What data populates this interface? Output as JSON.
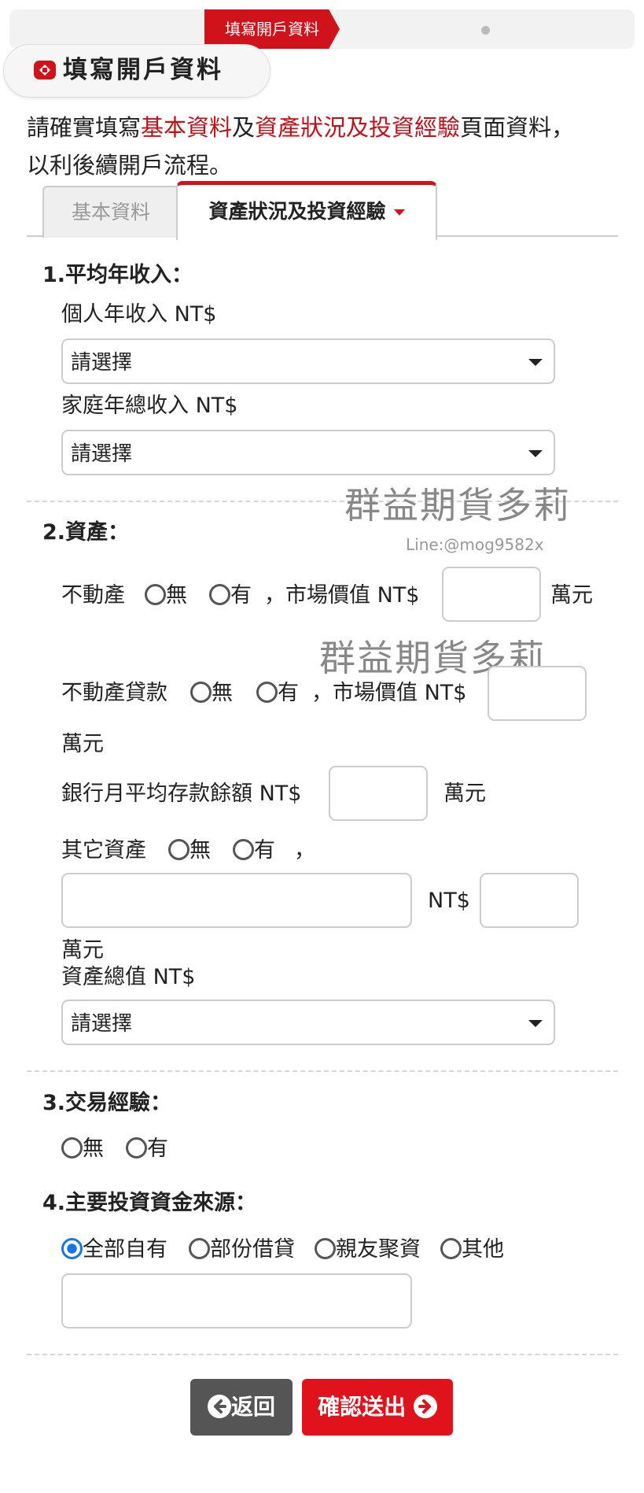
{
  "progress": {
    "active_step": "填寫開戶資料"
  },
  "header": {
    "title": "填寫開戶資料"
  },
  "intro": {
    "part1": "請確實填寫",
    "link1": "基本資料",
    "part2": "及",
    "link2": "資產狀況及投資經驗",
    "part3": "頁面資料，",
    "line2": "以利後續開戶流程。"
  },
  "tabs": [
    {
      "label": "基本資料"
    },
    {
      "label": "資產狀況及投資經驗"
    }
  ],
  "income": {
    "heading": "1.平均年收入：",
    "personal_label": "個人年收入 NT$",
    "personal_value": "請選擇",
    "family_label": "家庭年總收入 NT$",
    "family_value": "請選擇"
  },
  "assets": {
    "heading": "2.資產：",
    "real_estate": {
      "label": "不動產",
      "no": "無",
      "yes": "有",
      "market_value": "，市場價值 NT$",
      "unit": "萬元"
    },
    "real_estate_loan": {
      "label": "不動產貸款",
      "no": "無",
      "yes": "有",
      "market_value": "，市場價值 NT$",
      "unit": "萬元"
    },
    "bank_deposit": {
      "label": "銀行月平均存款餘額 NT$",
      "unit": "萬元"
    },
    "other_assets": {
      "label": "其它資產",
      "no": "無",
      "yes": "有",
      "comma": "，",
      "nt": "NT$",
      "unit": "萬元"
    },
    "total": {
      "label": "資產總值 NT$",
      "value": "請選擇"
    }
  },
  "trading": {
    "heading": "3.交易經驗：",
    "no": "無",
    "yes": "有"
  },
  "funds": {
    "heading": "4.主要投資資金來源：",
    "options": [
      "全部自有",
      "部份借貸",
      "親友聚資",
      "其他"
    ],
    "selected": "全部自有"
  },
  "watermark": {
    "text": "群益期貨多莉",
    "line": "Line:@mog9582x"
  },
  "buttons": {
    "back": "返回",
    "submit": "確認送出"
  },
  "colors": {
    "accent": "#d0121b",
    "radio_selected": "#1a73e8",
    "back_button": "#555555"
  }
}
